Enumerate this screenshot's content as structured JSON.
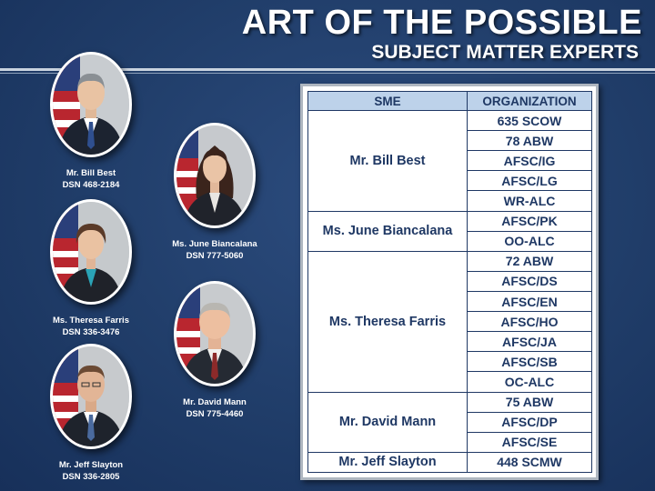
{
  "slide": {
    "title": "ART OF THE POSSIBLE",
    "subtitle": "SUBJECT MATTER EXPERTS"
  },
  "experts": [
    {
      "name": "Mr. Bill Best",
      "dsn": "DSN 468-2184"
    },
    {
      "name": "Ms. June Biancalana",
      "dsn": "DSN 777-5060"
    },
    {
      "name": "Ms. Theresa Farris",
      "dsn": "DSN 336-3476"
    },
    {
      "name": "Mr. David Mann",
      "dsn": "DSN 775-4460"
    },
    {
      "name": "Mr. Jeff Slayton",
      "dsn": "DSN 336-2805"
    }
  ],
  "table": {
    "headers": {
      "sme": "SME",
      "organization": "ORGANIZATION"
    },
    "groups": [
      {
        "sme": "Mr. Bill Best",
        "orgs": [
          "635 SCOW",
          "78 ABW",
          "AFSC/IG",
          "AFSC/LG",
          "WR-ALC"
        ]
      },
      {
        "sme": "Ms. June Biancalana",
        "orgs": [
          "AFSC/PK",
          "OO-ALC"
        ]
      },
      {
        "sme": "Ms. Theresa Farris",
        "orgs": [
          "72 ABW",
          "AFSC/DS",
          "AFSC/EN",
          "AFSC/HO",
          "AFSC/JA",
          "AFSC/SB",
          "OC-ALC"
        ]
      },
      {
        "sme": "Mr. David Mann",
        "orgs": [
          "75 ABW",
          "AFSC/DP",
          "AFSC/SE"
        ]
      },
      {
        "sme": "Mr. Jeff Slayton",
        "orgs": [
          "448 SCMW"
        ]
      }
    ]
  },
  "colors": {
    "background": "#1f3a64",
    "table_header": "#bdd2ea",
    "table_text": "#1f3864"
  }
}
